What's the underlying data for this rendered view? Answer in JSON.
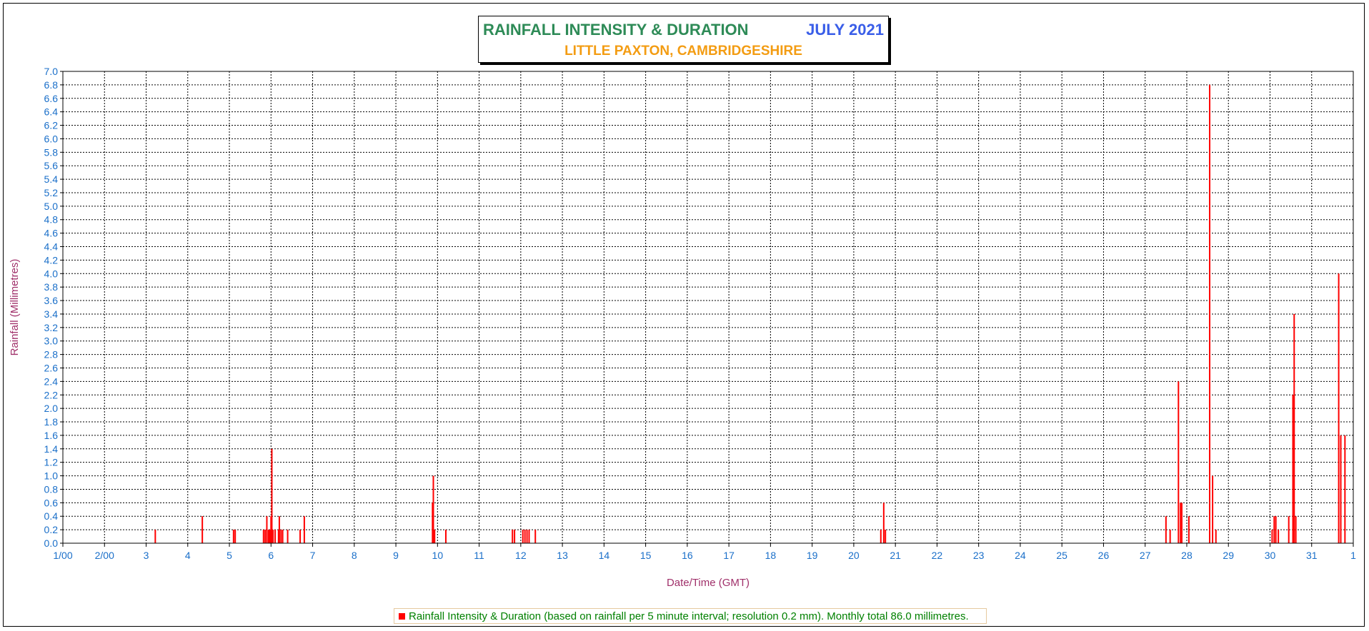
{
  "header": {
    "title": "RAINFALL INTENSITY & DURATION",
    "period": "JULY 2021",
    "location": "LITTLE PAXTON, CAMBRIDGESHIRE"
  },
  "legend": {
    "text": "Rainfall Intensity & Duration (based on rainfall per 5 minute interval; resolution 0.2 mm). Monthly total 86.0 millimetres."
  },
  "colors": {
    "bars": "#ff0000",
    "title": "#2e8b57",
    "period": "#3a5ee8",
    "location": "#f39c12",
    "tick_labels": "#1a6fc9",
    "axis_titles": "#a0306a",
    "legend_text": "#008000"
  },
  "chart_data": {
    "type": "bar",
    "title": "RAINFALL INTENSITY & DURATION JULY 2021",
    "subtitle": "LITTLE PAXTON, CAMBRIDGESHIRE",
    "xlabel": "Date/Time (GMT)",
    "ylabel": "Rainfall (Millimetres)",
    "xlim": [
      1,
      32
    ],
    "ylim": [
      0,
      7.0
    ],
    "y_step": 0.2,
    "grid": true,
    "legend_position": "bottom",
    "x_tick_labels": [
      "1/00",
      "2/00",
      "3",
      "4",
      "5",
      "6",
      "7",
      "8",
      "9",
      "10",
      "11",
      "12",
      "13",
      "14",
      "15",
      "16",
      "17",
      "18",
      "19",
      "20",
      "21",
      "22",
      "23",
      "24",
      "25",
      "26",
      "27",
      "28",
      "29",
      "30",
      "31",
      "1"
    ],
    "series": [
      {
        "name": "Rainfall Intensity & Duration",
        "points": [
          [
            3.22,
            0.2
          ],
          [
            4.35,
            0.4
          ],
          [
            5.1,
            0.2
          ],
          [
            5.14,
            0.2
          ],
          [
            5.82,
            0.2
          ],
          [
            5.86,
            0.2
          ],
          [
            5.9,
            0.4
          ],
          [
            5.94,
            0.2
          ],
          [
            5.97,
            0.2
          ],
          [
            6.0,
            0.4
          ],
          [
            6.02,
            1.4
          ],
          [
            6.05,
            0.2
          ],
          [
            6.1,
            0.2
          ],
          [
            6.18,
            0.2
          ],
          [
            6.2,
            0.4
          ],
          [
            6.24,
            0.2
          ],
          [
            6.28,
            0.2
          ],
          [
            6.4,
            0.2
          ],
          [
            6.7,
            0.2
          ],
          [
            6.8,
            0.4
          ],
          [
            9.88,
            0.6
          ],
          [
            9.9,
            1.0
          ],
          [
            9.93,
            0.2
          ],
          [
            10.2,
            0.2
          ],
          [
            11.8,
            0.2
          ],
          [
            11.85,
            0.2
          ],
          [
            12.05,
            0.2
          ],
          [
            12.1,
            0.2
          ],
          [
            12.15,
            0.2
          ],
          [
            12.2,
            0.2
          ],
          [
            12.35,
            0.2
          ],
          [
            20.65,
            0.2
          ],
          [
            20.72,
            0.6
          ],
          [
            20.76,
            0.2
          ],
          [
            27.5,
            0.4
          ],
          [
            27.6,
            0.2
          ],
          [
            27.8,
            2.4
          ],
          [
            27.85,
            0.6
          ],
          [
            27.88,
            0.6
          ],
          [
            28.05,
            0.4
          ],
          [
            28.55,
            6.8
          ],
          [
            28.62,
            1.0
          ],
          [
            28.7,
            0.2
          ],
          [
            30.05,
            0.2
          ],
          [
            30.1,
            0.4
          ],
          [
            30.14,
            0.4
          ],
          [
            30.2,
            0.2
          ],
          [
            30.45,
            0.4
          ],
          [
            30.55,
            2.2
          ],
          [
            30.58,
            3.4
          ],
          [
            30.62,
            0.4
          ],
          [
            31.65,
            4.0
          ],
          [
            31.7,
            1.6
          ],
          [
            31.8,
            1.6
          ]
        ]
      }
    ]
  }
}
